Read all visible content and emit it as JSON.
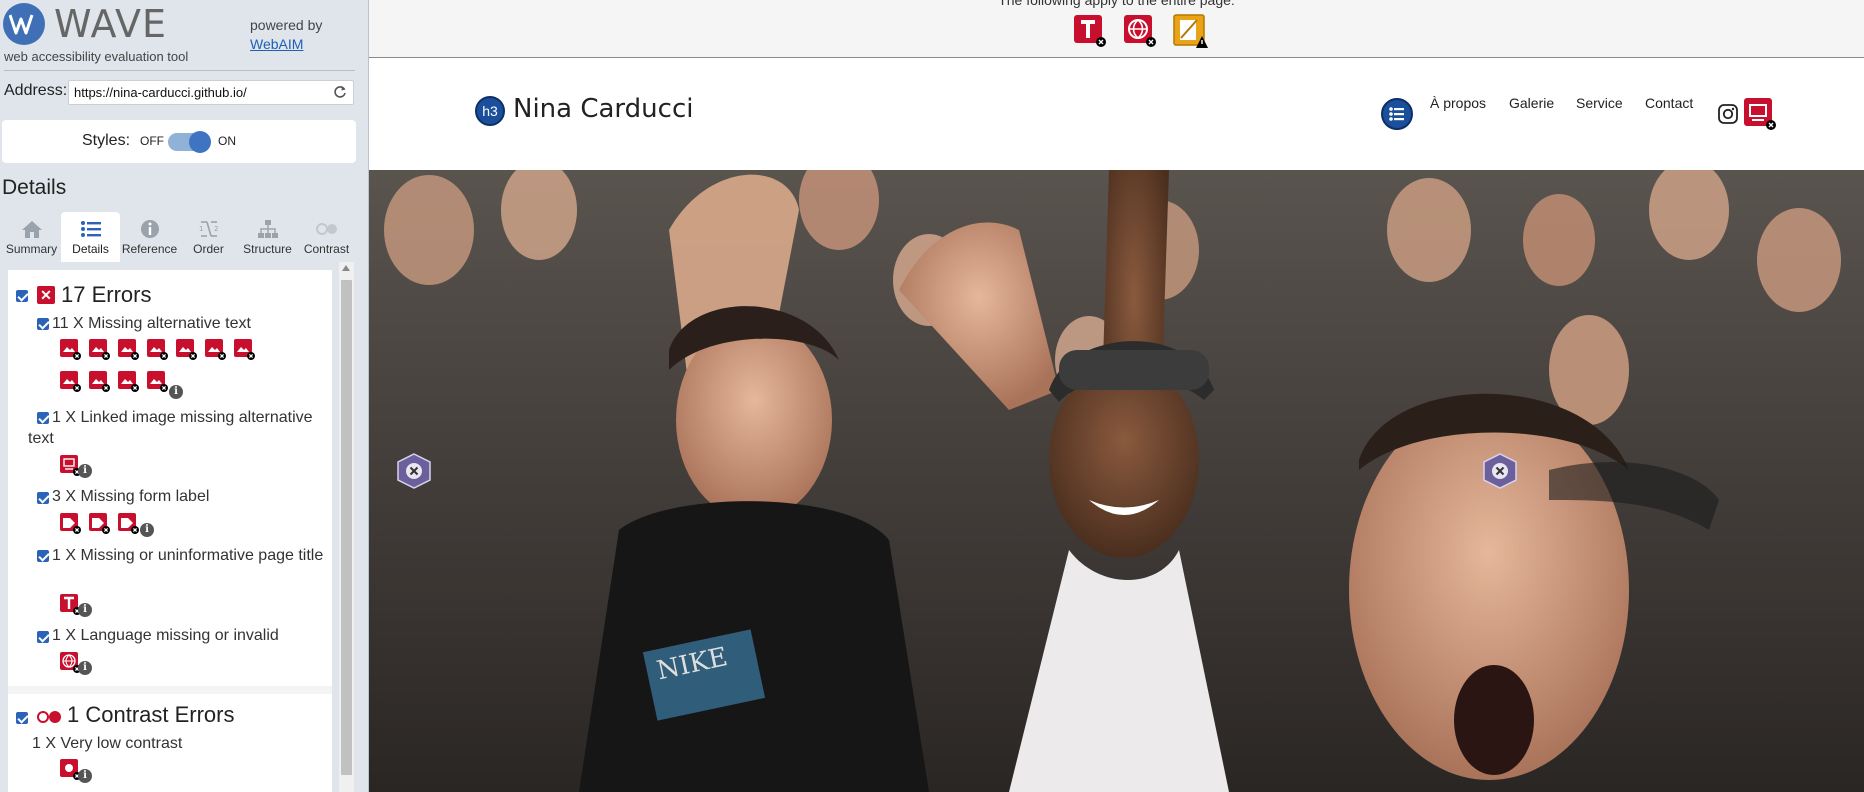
{
  "wave": {
    "brand_name": "WAVE",
    "tagline": "web accessibility evaluation tool",
    "powered_by": "powered by",
    "powered_link": "WebAIM",
    "address_label": "Address:",
    "address_value": "https://nina-carducci.github.io/",
    "styles_label": "Styles:",
    "styles_off": "OFF",
    "styles_on": "ON",
    "styles_enabled": true,
    "details_heading": "Details",
    "tabs": [
      {
        "label": "Summary",
        "icon": "home-icon",
        "active": false
      },
      {
        "label": "Details",
        "icon": "list-icon",
        "active": true
      },
      {
        "label": "Reference",
        "icon": "info-icon",
        "active": false
      },
      {
        "label": "Order",
        "icon": "order-icon",
        "active": false
      },
      {
        "label": "Structure",
        "icon": "structure-icon",
        "active": false
      },
      {
        "label": "Contrast",
        "icon": "contrast-icon",
        "active": false
      }
    ],
    "errors": {
      "title": "17 Errors",
      "items": [
        {
          "text": "11 X Missing alternative text",
          "count": 11,
          "icon": "missing-alt-icon"
        },
        {
          "text": "1 X Linked image missing alternative text",
          "count": 1,
          "icon": "linked-image-alt-icon"
        },
        {
          "text": "3 X Missing form label",
          "count": 3,
          "icon": "missing-label-icon"
        },
        {
          "text": "1 X Missing or uninformative page title",
          "count": 1,
          "icon": "page-title-icon"
        },
        {
          "text": "1 X Language missing or invalid",
          "count": 1,
          "icon": "language-icon"
        }
      ]
    },
    "contrast": {
      "title": "1 Contrast Errors",
      "items": [
        {
          "text": "1 X Very low contrast",
          "count": 1,
          "icon": "low-contrast-icon"
        }
      ]
    }
  },
  "page": {
    "topbar_text": "The following apply to the entire page:",
    "site_title": "Nina Carducci",
    "heading_badge": "h3",
    "nav": [
      "À propos",
      "Galerie",
      "Service",
      "Contact"
    ]
  },
  "colors": {
    "error_red": "#c8102e",
    "wave_blue": "#1b4f9c",
    "alert_yellow": "#e8a317"
  }
}
